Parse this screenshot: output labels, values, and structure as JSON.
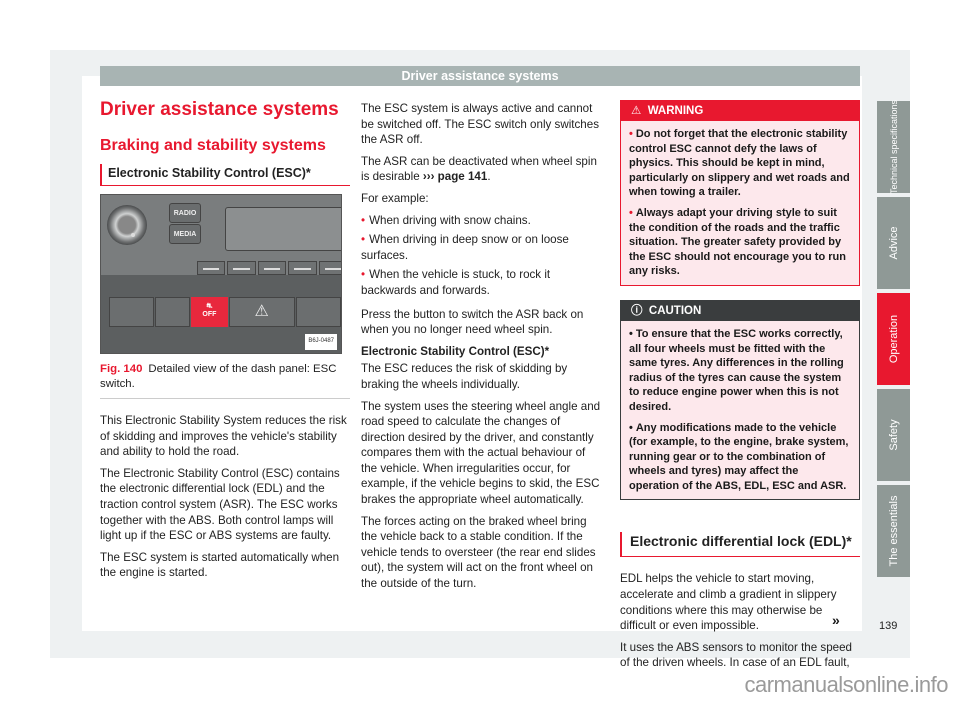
{
  "header": {
    "title": "Driver assistance systems"
  },
  "col1": {
    "h1": "Driver assistance systems",
    "h2": "Braking and stability systems",
    "h3": "Electronic Stability Control (ESC)*",
    "figure": {
      "buttons": {
        "radio": "RADIO",
        "media": "MEDIA",
        "esc_off": "OFF",
        "hazard": "⚠"
      },
      "code": "B6J-0487",
      "caption_num": "Fig. 140",
      "caption_text": "Detailed view of the dash panel: ESC switch."
    },
    "paragraphs": [
      "This Electronic Stability System reduces the risk of skidding and improves the vehicle's stability and ability to hold the road.",
      "The Electronic Stability Control (ESC) contains the electronic differential lock (EDL) and the traction control system (ASR). The ESC works together with the ABS. Both control lamps will light up if the ESC or ABS systems are faulty.",
      "The ESC system is started automatically when the engine is started."
    ]
  },
  "col2": {
    "p1": "The ESC system is always active and cannot be switched off. The ESC switch only switches the ASR off.",
    "p2_text": "The ASR can be deactivated when wheel spin is desirable ",
    "p2_link": "››› page 141",
    "p2_end": ".",
    "p3": "For example:",
    "bullets": [
      "When driving with snow chains.",
      "When driving in deep snow or on loose surfaces.",
      "When the vehicle is stuck, to rock it backwards and forwards."
    ],
    "p4": "Press the button to switch the ASR back on when you no longer need wheel spin.",
    "sub_head": "Electronic Stability Control (ESC)*",
    "p5": "The ESC reduces the risk of skidding by braking the wheels individually.",
    "p6": "The system uses the steering wheel angle and road speed to calculate the changes of direction desired by the driver, and constantly compares them with the actual behaviour of the vehicle. When irregularities occur, for example, if the vehicle begins to skid, the ESC brakes the appropriate wheel automatically.",
    "p7": "The forces acting on the braked wheel bring the vehicle back to a stable condition. If the vehicle tends to oversteer (the rear end slides out), the system will act on the front wheel on the outside of the turn."
  },
  "col3": {
    "warning": {
      "icon": "⚠",
      "title": "WARNING",
      "items": [
        "Do not forget that the electronic stability control ESC cannot defy the laws of physics. This should be kept in mind, particularly on slippery and wet roads and when towing a trailer.",
        "Always adapt your driving style to suit the condition of the roads and the traffic situation. The greater safety provided by the ESC should not encourage you to run any risks."
      ]
    },
    "caution": {
      "icon": "ⓘ",
      "title": "CAUTION",
      "items": [
        "To ensure that the ESC works correctly, all four wheels must be fitted with the same tyres. Any differences in the rolling radius of the tyres can cause the system to reduce engine power when this is not desired.",
        "Any modifications made to the vehicle (for example, to the engine, brake system, running gear or to the combination of wheels and tyres) may affect the operation of the ABS, EDL, ESC and ASR."
      ]
    },
    "edl_head": "Electronic differential lock (EDL)*",
    "edl_p1": "EDL helps the vehicle to start moving, accelerate and climb a gradient in slippery conditions where this may otherwise be difficult or even impossible.",
    "edl_p2": "It uses the ABS sensors to monitor the speed of the driven wheels. In case of an EDL fault,",
    "continue_marker": "»"
  },
  "side_tabs": [
    {
      "label": "Technical specifications",
      "active": false
    },
    {
      "label": "Advice",
      "active": false
    },
    {
      "label": "Operation",
      "active": true
    },
    {
      "label": "Safety",
      "active": false
    },
    {
      "label": "The essentials",
      "active": false
    }
  ],
  "page_number": "139",
  "watermark": "carmanualsonline.info",
  "colors": {
    "accent": "#e8182f",
    "header_bar": "#a8b4b3",
    "tab_gray": "#8f9996",
    "caution_dark": "#3a3d3e"
  }
}
